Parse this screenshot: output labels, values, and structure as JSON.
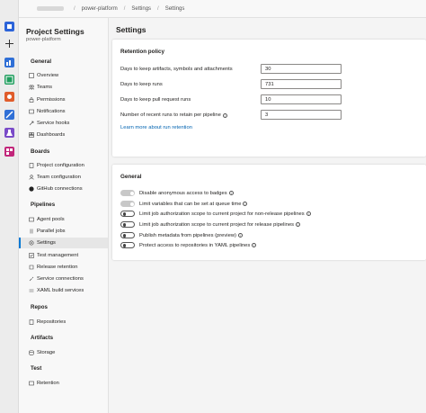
{
  "breadcrumb": {
    "project": "power-platform",
    "section": "Settings",
    "page": "Settings"
  },
  "rail": {
    "icons": [
      "azure-devops-logo-icon",
      "plus-icon",
      "overview-icon",
      "boards-icon",
      "repos-icon",
      "pipelines-icon",
      "test-plans-icon",
      "artifacts-icon"
    ]
  },
  "sidebar": {
    "title": "Project Settings",
    "subtitle": "power-platform",
    "sections": {
      "general": "General",
      "boards": "Boards",
      "pipelines": "Pipelines",
      "repos": "Repos",
      "artifacts": "Artifacts",
      "test": "Test"
    },
    "items": {
      "overview": "Overview",
      "teams": "Teams",
      "permissions": "Permissions",
      "notifications": "Notifications",
      "service_hooks": "Service hooks",
      "dashboards": "Dashboards",
      "project_configuration": "Project configuration",
      "team_configuration": "Team configuration",
      "github_connections": "GitHub connections",
      "agent_pools": "Agent pools",
      "parallel_jobs": "Parallel jobs",
      "settings": "Settings",
      "test_management": "Test management",
      "release_retention": "Release retention",
      "service_connections": "Service connections",
      "xaml_build_services": "XAML build services",
      "repositories": "Repositories",
      "storage": "Storage",
      "retention": "Retention"
    },
    "selected": "settings"
  },
  "main": {
    "title": "Settings",
    "retention": {
      "title": "Retention policy",
      "rows": [
        {
          "label": "Days to keep artifacts, symbols and attachments",
          "value": "30"
        },
        {
          "label": "Days to keep runs",
          "value": "731"
        },
        {
          "label": "Days to keep pull request runs",
          "value": "10"
        },
        {
          "label": "Number of recent runs to retain per pipeline",
          "value": "3"
        }
      ],
      "link": "Learn more about run retention"
    },
    "general": {
      "title": "General",
      "toggles": [
        {
          "label": "Disable anonymous access to badges",
          "on": true,
          "info": true
        },
        {
          "label": "Limit variables that can be set at queue time",
          "on": true,
          "info": true
        },
        {
          "label": "Limit job authorization scope to current project for non-release pipelines",
          "on": false,
          "info": true
        },
        {
          "label": "Limit job authorization scope to current project for release pipelines",
          "on": false,
          "info": true
        },
        {
          "label": "Publish metadata from pipelines (preview)",
          "on": false,
          "info": true
        },
        {
          "label": "Protect access to repositories in YAML pipelines",
          "on": false,
          "info": true
        }
      ]
    }
  },
  "colors": {
    "accent": "#0078d4",
    "link": "#0063b1"
  }
}
